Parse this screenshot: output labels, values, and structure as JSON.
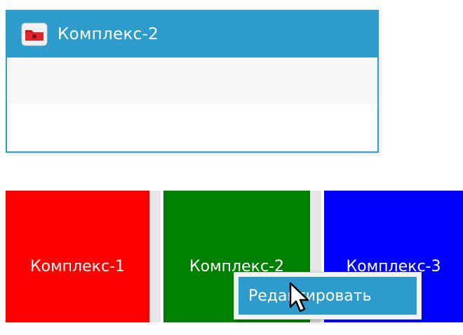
{
  "list": {
    "selected_item": {
      "label": "Комплекс-2",
      "icon": "folder-icon"
    },
    "colors": {
      "border": "#2f9fc7",
      "selection": "#2d9bcb"
    }
  },
  "panels": [
    {
      "label": "Комплекс-1",
      "color": "#ff0000"
    },
    {
      "label": "Комплекс-2",
      "color": "#008000"
    },
    {
      "label": "Комплекс-3",
      "color": "#0000ff"
    }
  ],
  "context_menu": {
    "items": [
      {
        "label": "Редактировать"
      }
    ]
  },
  "cursor": {
    "icon": "arrow-cursor-icon"
  }
}
